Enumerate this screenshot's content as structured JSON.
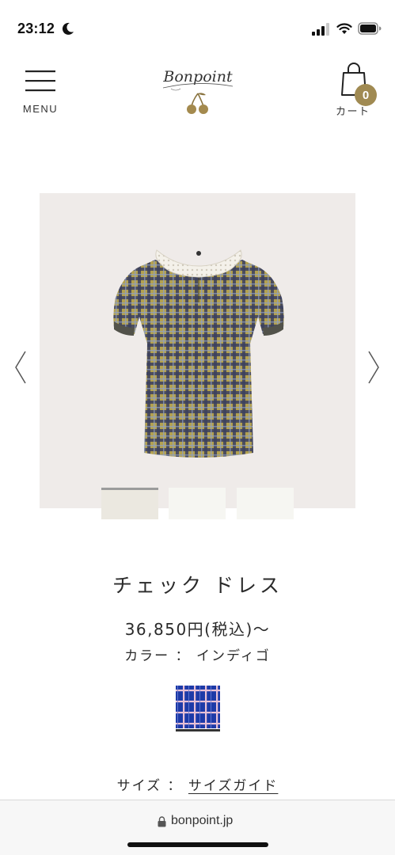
{
  "status_bar": {
    "time": "23:12",
    "icons": [
      "moon-icon",
      "signal-icon",
      "wifi-icon",
      "battery-icon"
    ]
  },
  "header": {
    "menu_label": "MENU",
    "logo_text": "Bonpoint",
    "cart_label": "カート",
    "cart_count": "0",
    "icons": [
      "hamburger-menu-icon",
      "cherry-logo-icon",
      "shopping-bag-icon"
    ]
  },
  "gallery": {
    "thumbnail_count": 3,
    "active_thumbnail": 1,
    "icons": [
      "chevron-left-icon",
      "chevron-right-icon"
    ]
  },
  "product": {
    "title": "チェック ドレス",
    "price": "36,850円(税込)～",
    "color_label": "カラー",
    "color_separator": "：",
    "color_value": "インディゴ",
    "size_label": "サイズ",
    "size_separator": "：",
    "size_guide_link": "サイズガイド"
  },
  "browser": {
    "url": "bonpoint.jp"
  },
  "colors": {
    "gallery_bg": "#efebe9",
    "badge": "#a08a52",
    "swatch_blue": "#1d3aa8",
    "dress_plaid": "#6b6a3c"
  }
}
